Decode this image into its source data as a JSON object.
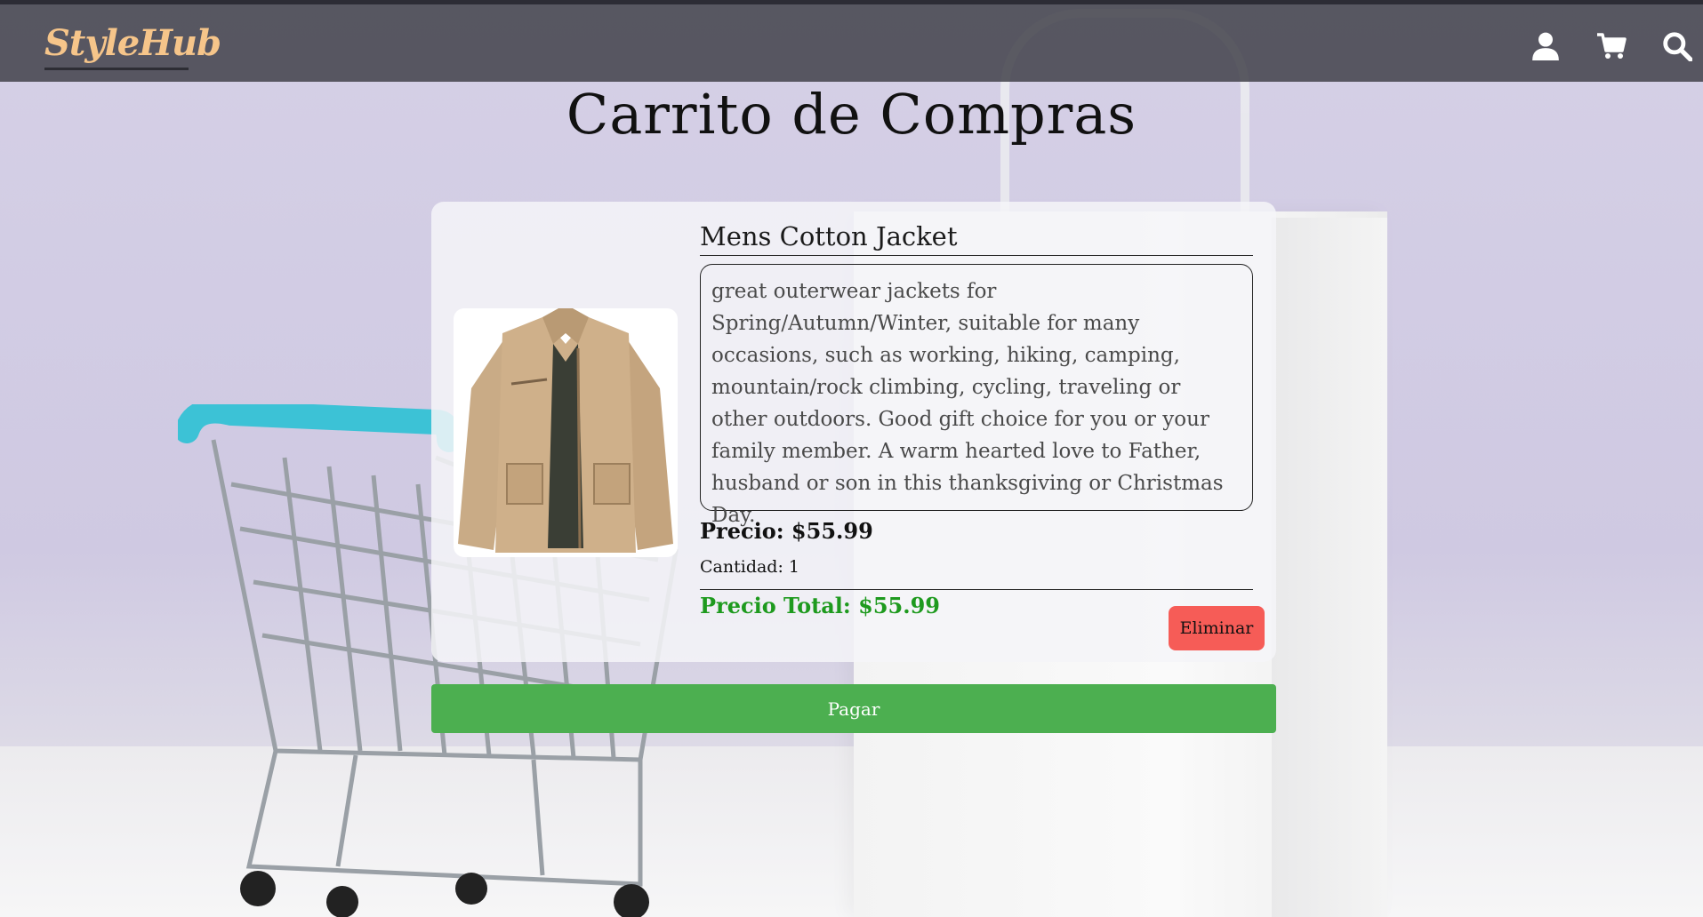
{
  "app": {
    "logo": "StyleHub"
  },
  "nav": {
    "icons": [
      "user-icon",
      "cart-icon",
      "search-icon"
    ]
  },
  "page": {
    "title": "Carrito de Compras"
  },
  "cart_item": {
    "name": "Mens Cotton Jacket",
    "description": "great outerwear jackets for Spring/Autumn/Winter, suitable for many occasions, such as working, hiking, camping, mountain/rock climbing, cycling, traveling or other outdoors. Good gift choice for you or your family member. A warm hearted love to Father, husband or son in this thanksgiving or Christmas Day.",
    "price": "Precio: $55.99",
    "quantity": "Cantidad: 1",
    "total": "Precio Total: $55.99",
    "remove_label": "Eliminar"
  },
  "checkout": {
    "pay_label": "Pagar"
  },
  "colors": {
    "navbar": "#46464e",
    "logo": "#f6c58a",
    "total": "#1e9a1e",
    "remove": "#f65c57",
    "pay": "#4caf50"
  }
}
